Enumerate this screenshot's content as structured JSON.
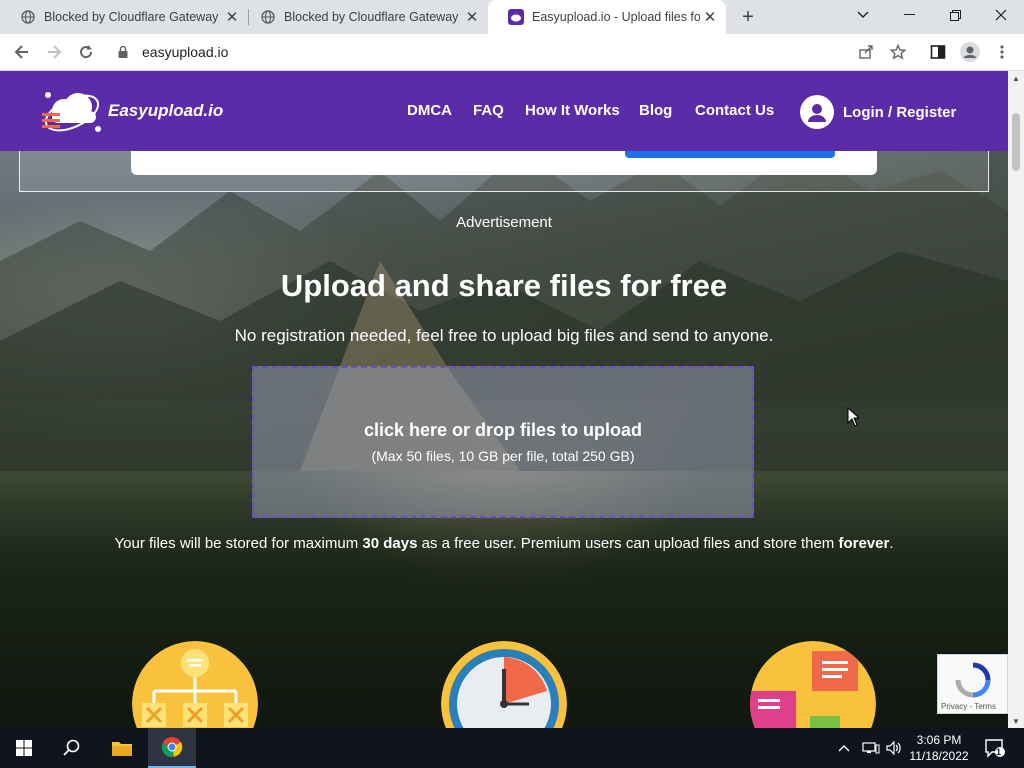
{
  "browser": {
    "tabs": [
      {
        "title": "Blocked by Cloudflare Gateway",
        "active": false
      },
      {
        "title": "Blocked by Cloudflare Gateway",
        "active": false
      },
      {
        "title": "Easyupload.io - Upload files for f",
        "active": true
      }
    ],
    "url": "easyupload.io"
  },
  "site": {
    "logo_text": "Easyupload.io",
    "nav": [
      "DMCA",
      "FAQ",
      "How It Works",
      "Blog",
      "Contact Us"
    ],
    "login_label": "Login / Register",
    "advertisement_label": "Advertisement",
    "hero_title": "Upload and share files for free",
    "hero_subtitle": "No registration needed, feel free to upload big files and send to anyone.",
    "dropzone_main": "click here or drop files to upload",
    "dropzone_sub": "(Max 50 files, 10 GB per file, total 250 GB)",
    "notice_part1": "Your files will be stored for maximum ",
    "notice_bold1": "30 days",
    "notice_part2": " as a free user. Premium users can upload files and store them ",
    "notice_bold2": "forever",
    "notice_end": ".",
    "recaptcha_terms": "Privacy - Terms"
  },
  "taskbar": {
    "time": "3:06 PM",
    "date": "11/18/2022",
    "notification_count": "1"
  },
  "colors": {
    "brand_purple": "#5a2ca8",
    "dropzone_border": "#6a4fc0"
  }
}
